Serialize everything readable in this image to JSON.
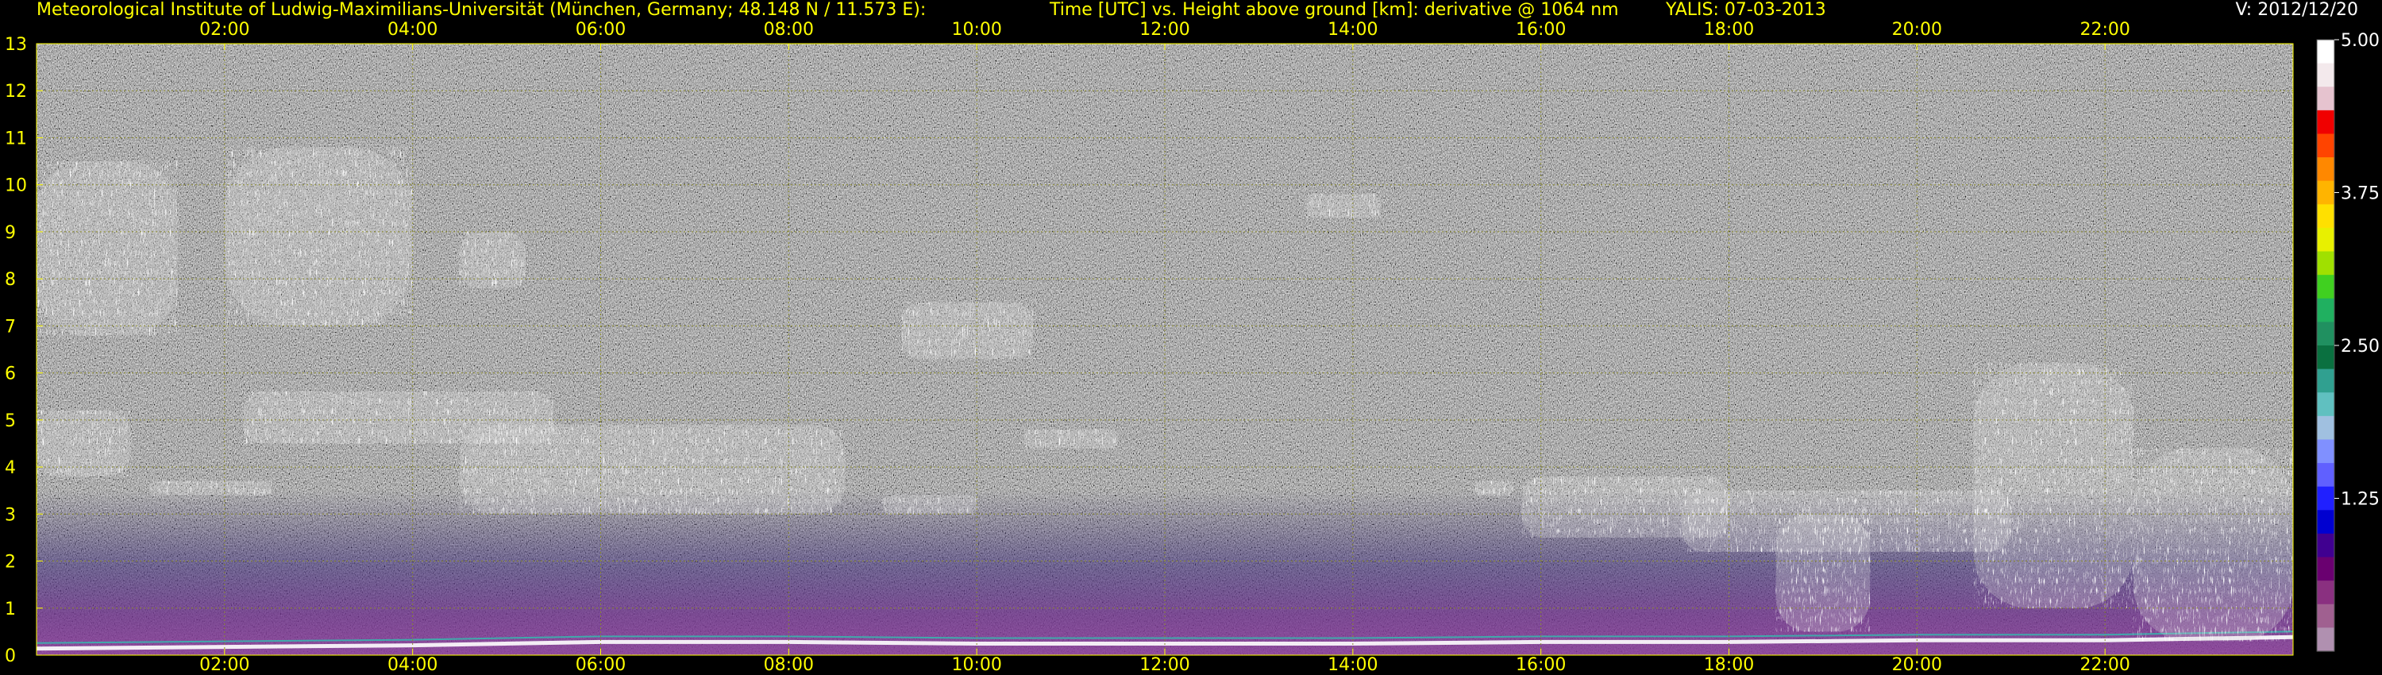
{
  "header": {
    "institute": "Meteorological Institute of Ludwig-Maximilians-Universität (München, Germany; 48.148 N / 11.573 E):",
    "title": "Time [UTC] vs. Height above ground [km]: derivative @ 1064 nm",
    "instrument": "YALIS: 07-03-2013",
    "version": "V: 2012/12/20"
  },
  "chart_data": {
    "type": "heatmap",
    "title": "Time [UTC] vs. Height above ground [km]: derivative @ 1064 nm",
    "xlabel": "Time [UTC]",
    "ylabel": "Height above ground [km]",
    "xlim": [
      0,
      24
    ],
    "ylim": [
      0,
      13
    ],
    "x_ticks": [
      "02:00",
      "04:00",
      "06:00",
      "08:00",
      "10:00",
      "12:00",
      "14:00",
      "16:00",
      "18:00",
      "20:00",
      "22:00"
    ],
    "y_ticks": [
      "0",
      "1",
      "2",
      "3",
      "4",
      "5",
      "6",
      "7",
      "8",
      "9",
      "10",
      "11",
      "12",
      "13"
    ],
    "grid": true,
    "colorbar": {
      "range": [
        0,
        5.0
      ],
      "tick_labels": [
        "5.00",
        "3.75",
        "2.50",
        "1.25"
      ],
      "tick_values": [
        5.0,
        3.75,
        2.5,
        1.25
      ]
    },
    "cloud_layers": [
      {
        "t_start": 0.0,
        "t_end": 1.5,
        "h_low": 6.8,
        "h_high": 10.5
      },
      {
        "t_start": 2.0,
        "t_end": 4.0,
        "h_low": 7.0,
        "h_high": 10.8
      },
      {
        "t_start": 4.5,
        "t_end": 5.2,
        "h_low": 7.8,
        "h_high": 9.0
      },
      {
        "t_start": 0.0,
        "t_end": 1.0,
        "h_low": 3.8,
        "h_high": 5.2
      },
      {
        "t_start": 1.2,
        "t_end": 2.5,
        "h_low": 3.4,
        "h_high": 3.7
      },
      {
        "t_start": 2.2,
        "t_end": 5.5,
        "h_low": 4.5,
        "h_high": 5.6
      },
      {
        "t_start": 4.5,
        "t_end": 8.6,
        "h_low": 3.0,
        "h_high": 4.9
      },
      {
        "t_start": 9.0,
        "t_end": 10.0,
        "h_low": 3.0,
        "h_high": 3.4
      },
      {
        "t_start": 10.5,
        "t_end": 11.5,
        "h_low": 4.4,
        "h_high": 4.8
      },
      {
        "t_start": 9.2,
        "t_end": 10.6,
        "h_low": 6.3,
        "h_high": 7.5
      },
      {
        "t_start": 13.5,
        "t_end": 14.3,
        "h_low": 9.3,
        "h_high": 9.8
      },
      {
        "t_start": 15.3,
        "t_end": 15.7,
        "h_low": 3.4,
        "h_high": 3.7
      },
      {
        "t_start": 15.8,
        "t_end": 18.0,
        "h_low": 2.5,
        "h_high": 3.8
      },
      {
        "t_start": 17.5,
        "t_end": 21.0,
        "h_low": 2.2,
        "h_high": 3.5
      },
      {
        "t_start": 18.5,
        "t_end": 19.5,
        "h_low": 0.5,
        "h_high": 3.0
      },
      {
        "t_start": 20.6,
        "t_end": 22.3,
        "h_low": 1.0,
        "h_high": 6.2
      },
      {
        "t_start": 22.3,
        "t_end": 24.0,
        "h_low": 0.3,
        "h_high": 4.4
      }
    ],
    "boundary_layer_top_km": [
      0.4,
      0.5,
      0.6,
      0.8,
      0.8,
      0.7,
      0.7,
      0.7,
      0.8,
      0.8,
      0.9,
      0.9,
      1.1
    ]
  },
  "colors": {
    "axis_text": "#ffff00",
    "grid": "#8a8a2a",
    "background": "#000000",
    "noise_gray": "#777777",
    "cloud": "#ffffff",
    "colorbar": [
      "#ffffff",
      "#f3e9ec",
      "#e6c3cf",
      "#f00000",
      "#ff4400",
      "#ff8800",
      "#ffb400",
      "#ffe000",
      "#e8f000",
      "#a0e000",
      "#40d020",
      "#20b060",
      "#209060",
      "#0a7040",
      "#30a090",
      "#60c0c0",
      "#a0c0e0",
      "#8090ff",
      "#6060ff",
      "#2020ff",
      "#0000d0",
      "#400090",
      "#6a0070",
      "#8a3080",
      "#a06090",
      "#b090b0"
    ]
  }
}
